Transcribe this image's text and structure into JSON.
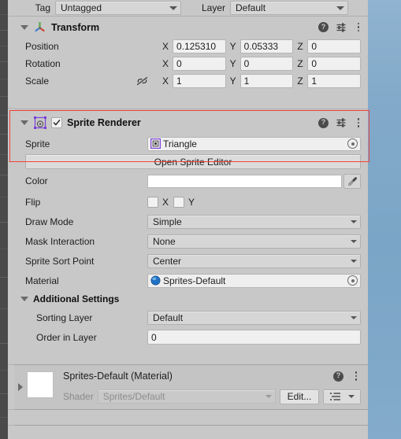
{
  "window": {
    "panel": "Inspector",
    "scene_background_color": "#7ea7c8",
    "panel_background_color": "#c8c8c8",
    "highlight_color": "#f0433c"
  },
  "tag_layer_row": {
    "tag_label": "Tag",
    "tag_value": "Untagged",
    "layer_label": "Layer",
    "layer_value": "Default"
  },
  "transform": {
    "title": "Transform",
    "icon": "transform-axis-gizmo-icon",
    "expanded": true,
    "help_icon": "help-icon",
    "preset_icon": "preset-settings-icon",
    "menu_icon": "kebab-menu-icon",
    "rows": [
      {
        "label": "Position",
        "axes": [
          {
            "axis": "X",
            "value": "0.125310"
          },
          {
            "axis": "Y",
            "value": "0.05333"
          },
          {
            "axis": "Z",
            "value": "0"
          }
        ]
      },
      {
        "label": "Rotation",
        "axes": [
          {
            "axis": "X",
            "value": "0"
          },
          {
            "axis": "Y",
            "value": "0"
          },
          {
            "axis": "Z",
            "value": "0"
          }
        ]
      },
      {
        "label": "Scale",
        "constrain_icon": "constrain-proportions-off-icon",
        "axes": [
          {
            "axis": "X",
            "value": "1"
          },
          {
            "axis": "Y",
            "value": "1"
          },
          {
            "axis": "Z",
            "value": "1"
          }
        ]
      }
    ]
  },
  "sprite_renderer": {
    "title": "Sprite Renderer",
    "icon": "sprite-renderer-icon",
    "enabled": true,
    "expanded": true,
    "help_icon": "help-icon",
    "preset_icon": "preset-settings-icon",
    "menu_icon": "kebab-menu-icon",
    "sprite": {
      "label": "Sprite",
      "value": "Triangle",
      "thumb_icon": "sprite-asset-icon",
      "picker_icon": "object-picker-icon"
    },
    "open_sprite_editor_label": "Open Sprite Editor",
    "color": {
      "label": "Color",
      "value": "#FFFFFF",
      "eyedropper_icon": "eyedropper-icon"
    },
    "flip": {
      "label": "Flip",
      "x_label": "X",
      "x_checked": false,
      "y_label": "Y",
      "y_checked": false
    },
    "draw_mode": {
      "label": "Draw Mode",
      "value": "Simple"
    },
    "mask_interaction": {
      "label": "Mask Interaction",
      "value": "None"
    },
    "sprite_sort_point": {
      "label": "Sprite Sort Point",
      "value": "Center"
    },
    "material": {
      "label": "Material",
      "value": "Sprites-Default",
      "thumb_icon": "material-sphere-icon",
      "picker_icon": "object-picker-icon"
    },
    "additional_settings": {
      "title": "Additional Settings",
      "expanded": true,
      "sorting_layer": {
        "label": "Sorting Layer",
        "value": "Default"
      },
      "order_in_layer": {
        "label": "Order in Layer",
        "value": "0"
      }
    }
  },
  "material_asset": {
    "title": "Sprites-Default (Material)",
    "preview_icon": "material-preview-swatch",
    "help_icon": "help-icon",
    "menu_icon": "kebab-menu-icon",
    "foldout_icon": "foldout-collapsed-icon",
    "shader_label": "Shader",
    "shader_value": "Sprites/Default",
    "edit_button_label": "Edit...",
    "shader_list_icon": "shader-list-icon"
  }
}
